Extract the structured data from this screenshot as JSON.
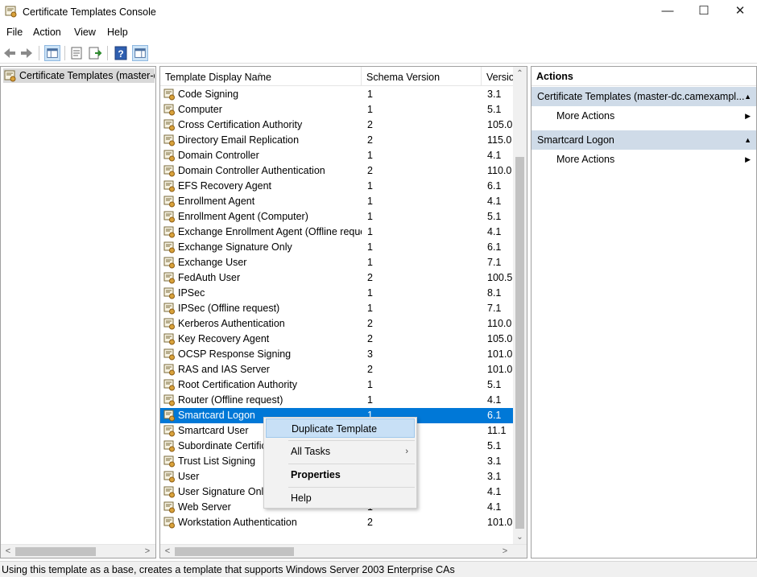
{
  "window": {
    "title": "Certificate Templates Console",
    "min": "—",
    "max": "☐",
    "close": "✕"
  },
  "menu": [
    "File",
    "Action",
    "View",
    "Help"
  ],
  "tree": {
    "root_label": "Certificate Templates (master-dc.camexample.local)"
  },
  "columns": {
    "name": "Template Display Name",
    "schema": "Schema Version",
    "version": "Versio"
  },
  "templates": [
    {
      "name": "Code Signing",
      "schema": "1",
      "version": "3.1"
    },
    {
      "name": "Computer",
      "schema": "1",
      "version": "5.1"
    },
    {
      "name": "Cross Certification Authority",
      "schema": "2",
      "version": "105.0"
    },
    {
      "name": "Directory Email Replication",
      "schema": "2",
      "version": "115.0"
    },
    {
      "name": "Domain Controller",
      "schema": "1",
      "version": "4.1"
    },
    {
      "name": "Domain Controller Authentication",
      "schema": "2",
      "version": "110.0"
    },
    {
      "name": "EFS Recovery Agent",
      "schema": "1",
      "version": "6.1"
    },
    {
      "name": "Enrollment Agent",
      "schema": "1",
      "version": "4.1"
    },
    {
      "name": "Enrollment Agent (Computer)",
      "schema": "1",
      "version": "5.1"
    },
    {
      "name": "Exchange Enrollment Agent (Offline request)",
      "schema": "1",
      "version": "4.1"
    },
    {
      "name": "Exchange Signature Only",
      "schema": "1",
      "version": "6.1"
    },
    {
      "name": "Exchange User",
      "schema": "1",
      "version": "7.1"
    },
    {
      "name": "FedAuth User",
      "schema": "2",
      "version": "100.5"
    },
    {
      "name": "IPSec",
      "schema": "1",
      "version": "8.1"
    },
    {
      "name": "IPSec (Offline request)",
      "schema": "1",
      "version": "7.1"
    },
    {
      "name": "Kerberos Authentication",
      "schema": "2",
      "version": "110.0"
    },
    {
      "name": "Key Recovery Agent",
      "schema": "2",
      "version": "105.0"
    },
    {
      "name": "OCSP Response Signing",
      "schema": "3",
      "version": "101.0"
    },
    {
      "name": "RAS and IAS Server",
      "schema": "2",
      "version": "101.0"
    },
    {
      "name": "Root Certification Authority",
      "schema": "1",
      "version": "5.1"
    },
    {
      "name": "Router (Offline request)",
      "schema": "1",
      "version": "4.1"
    },
    {
      "name": "Smartcard Logon",
      "schema": "1",
      "version": "6.1",
      "selected": true
    },
    {
      "name": "Smartcard User",
      "schema": "1",
      "version": "11.1"
    },
    {
      "name": "Subordinate Certification Authority",
      "schema": "1",
      "version": "5.1"
    },
    {
      "name": "Trust List Signing",
      "schema": "1",
      "version": "3.1"
    },
    {
      "name": "User",
      "schema": "1",
      "version": "3.1"
    },
    {
      "name": "User Signature Only",
      "schema": "1",
      "version": "4.1"
    },
    {
      "name": "Web Server",
      "schema": "1",
      "version": "4.1"
    },
    {
      "name": "Workstation Authentication",
      "schema": "2",
      "version": "101.0"
    }
  ],
  "actions": {
    "title": "Actions",
    "group1": "Certificate Templates (master-dc.camexampl...",
    "group1_more": "More Actions",
    "group2": "Smartcard Logon",
    "group2_more": "More Actions"
  },
  "context_menu": {
    "duplicate": "Duplicate Template",
    "all_tasks": "All Tasks",
    "properties": "Properties",
    "help": "Help"
  },
  "status": "Using this template as a base, creates a template that supports Windows Server 2003 Enterprise CAs",
  "colors": {
    "selection": "#0078d7",
    "action_group": "#cfdbe8",
    "menu_highlight": "#c8e0f6"
  }
}
